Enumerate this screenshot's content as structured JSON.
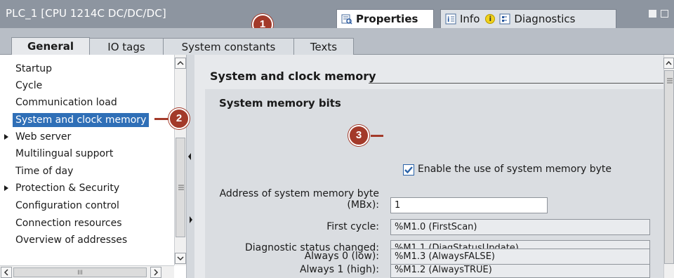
{
  "window": {
    "title": "PLC_1 [CPU 1214C DC/DC/DC]",
    "colors": {
      "title_bar": "#8d95a0",
      "selection": "#2f6fb7",
      "callout": "#a33a2a",
      "check": "#2b63a8"
    }
  },
  "panel_tabs": [
    {
      "label": "Properties",
      "icon": "properties-icon",
      "active": true
    },
    {
      "label": "Info",
      "icon": "info-icon",
      "badge": "i"
    },
    {
      "label": "Diagnostics",
      "icon": "diagnostics-icon"
    }
  ],
  "callouts": [
    "1",
    "2",
    "3"
  ],
  "tabs": [
    {
      "label": "General",
      "active": true
    },
    {
      "label": "IO tags"
    },
    {
      "label": "System constants"
    },
    {
      "label": "Texts"
    }
  ],
  "nav": {
    "items": [
      {
        "label": "Startup"
      },
      {
        "label": "Cycle"
      },
      {
        "label": "Communication load"
      },
      {
        "label": "System and clock memory",
        "selected": true
      },
      {
        "label": "Web server",
        "expandable": true
      },
      {
        "label": "Multilingual support"
      },
      {
        "label": "Time of day"
      },
      {
        "label": "Protection & Security",
        "expandable": true
      },
      {
        "label": "Configuration control"
      },
      {
        "label": "Connection resources"
      },
      {
        "label": "Overview of addresses"
      }
    ],
    "hscroll_grip": "III"
  },
  "main": {
    "section_title": "System and clock memory",
    "panel_title": "System memory bits",
    "enable_checkbox": {
      "label": "Enable the use of system memory byte",
      "checked": true
    },
    "address": {
      "label_line1": "Address of system memory byte",
      "label_line2": "(MBx):",
      "value": "1"
    },
    "bits": [
      {
        "label": "First cycle:",
        "value": "%M1.0 (FirstScan)"
      },
      {
        "label": "Diagnostic status changed:",
        "value": "%M1.1 (DiagStatusUpdate)"
      },
      {
        "label": "Always 1 (high):",
        "value": "%M1.2 (AlwaysTRUE)"
      },
      {
        "label": "Always 0 (low):",
        "value": "%M1.3 (AlwaysFALSE)"
      }
    ]
  }
}
